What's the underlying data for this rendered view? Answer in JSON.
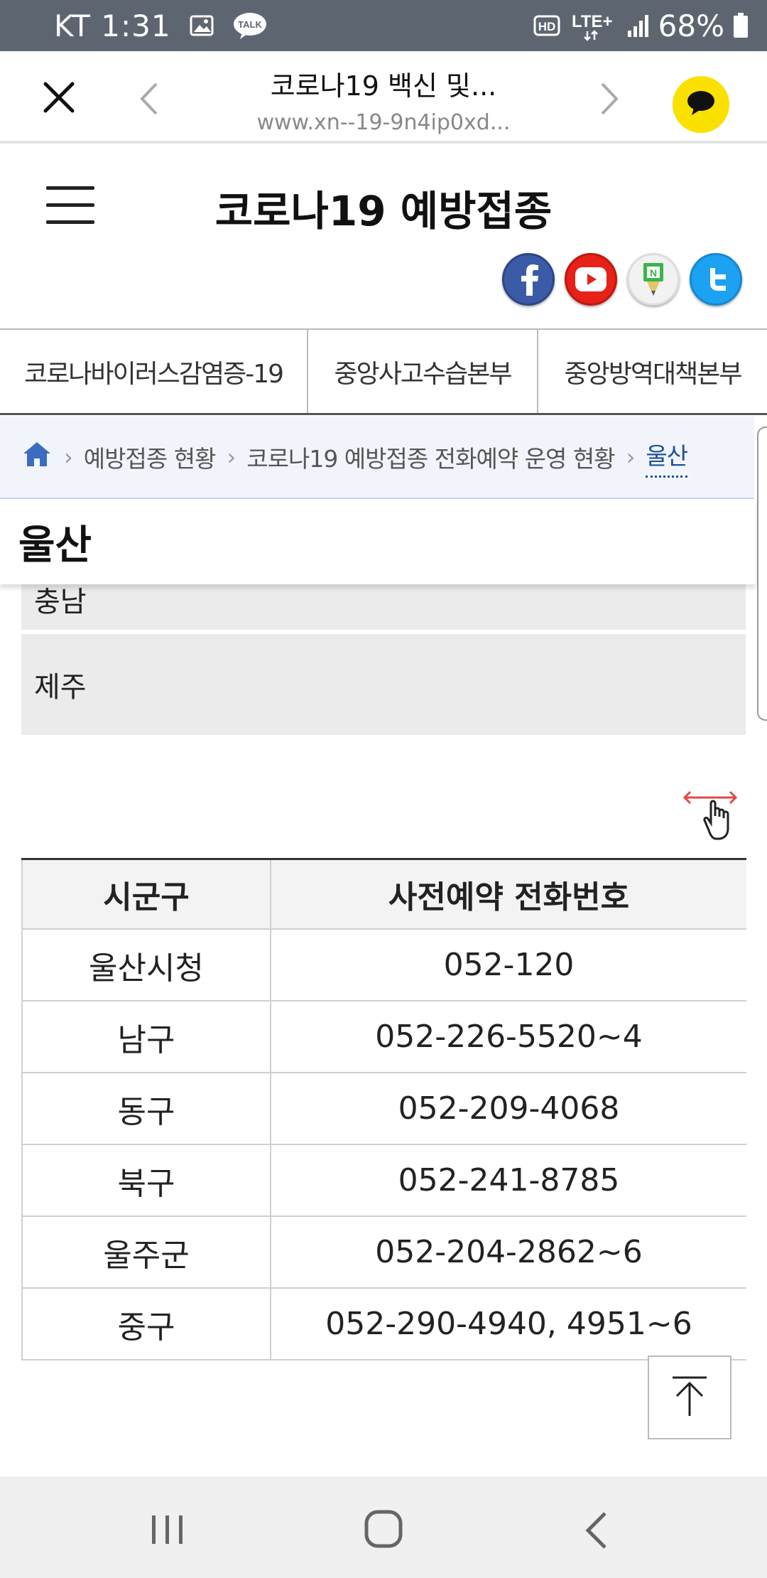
{
  "status_bar": {
    "carrier_time": "KT 1:31",
    "notification_icons": [
      "gallery-icon",
      "kakaotalk-icon"
    ],
    "talk_badge": "TALK",
    "hd_label": "HD",
    "network": "LTE+",
    "battery": "68%"
  },
  "browser": {
    "title": "코로나19 백신 및...",
    "url": "www.xn--19-9n4ip0xd..."
  },
  "site": {
    "title": "코로나19 예방접종",
    "social": [
      "facebook",
      "youtube",
      "naver-blog",
      "twitter"
    ]
  },
  "tabs": [
    {
      "label": "코로나바이러스감염증-19"
    },
    {
      "label": "중앙사고수습본부"
    },
    {
      "label": "중앙방역대책본부"
    }
  ],
  "breadcrumb": {
    "items": [
      "예방접종 현황",
      "코로나19 예방접종 전화예약 운영 현황"
    ],
    "current": "울산"
  },
  "page_heading": "울산",
  "regions": {
    "partial": "충남",
    "jeju": "제주"
  },
  "table": {
    "headers": [
      "시군구",
      "사전예약 전화번호"
    ],
    "rows": [
      [
        "울산시청",
        "052-120"
      ],
      [
        "남구",
        "052-226-5520~4"
      ],
      [
        "동구",
        "052-209-4068"
      ],
      [
        "북구",
        "052-241-8785"
      ],
      [
        "울주군",
        "052-204-2862~6"
      ],
      [
        "중구",
        "052-290-4940, 4951~6"
      ]
    ]
  },
  "colors": {
    "status_bar": "#5d6670",
    "kakao_yellow": "#fae100",
    "breadcrumb_current": "#1f4f9a",
    "row_bg": "#ebebeb"
  }
}
